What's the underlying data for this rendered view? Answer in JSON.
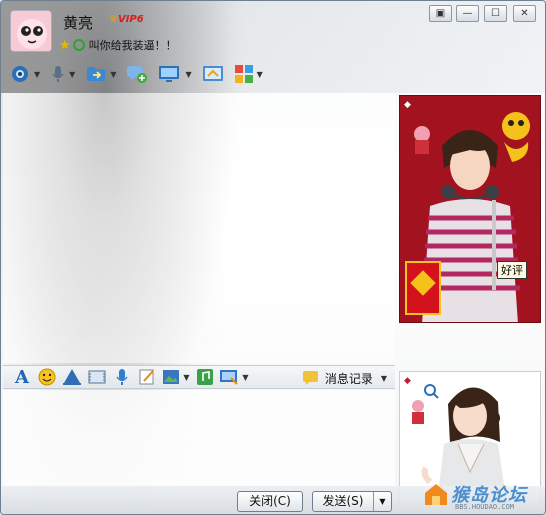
{
  "window": {
    "controls": [
      "▢▾",
      "—",
      "☐",
      "✕"
    ]
  },
  "contact": {
    "nickname": "黄亮",
    "vip_badge": "VIP6",
    "signature": "叫你给我装逼！！"
  },
  "top_toolbar": {
    "items": [
      "video-call-icon",
      "voice-call-icon",
      "send-file-icon",
      "create-discussion-icon",
      "remote-assist-icon",
      "app-share-icon",
      "apps-grid-icon"
    ]
  },
  "format_toolbar": {
    "history_label": "消息记录",
    "items": [
      "font-icon",
      "emoji-icon",
      "magic-icon",
      "screenshot-frame-icon",
      "voice-msg-icon",
      "handwrite-icon",
      "image-icon",
      "music-icon",
      "screen-capture-icon"
    ]
  },
  "show_panel": {
    "rating_label": "好评"
  },
  "buttons": {
    "close_label": "关闭(C)",
    "send_label": "发送(S)"
  },
  "watermark": {
    "text": "猴岛论坛",
    "url": "BBS.HOUDAO.COM"
  },
  "colors": {
    "accent": "#4b8fd1",
    "show_bg": "#a0121e",
    "vip": "#d61e1e"
  }
}
